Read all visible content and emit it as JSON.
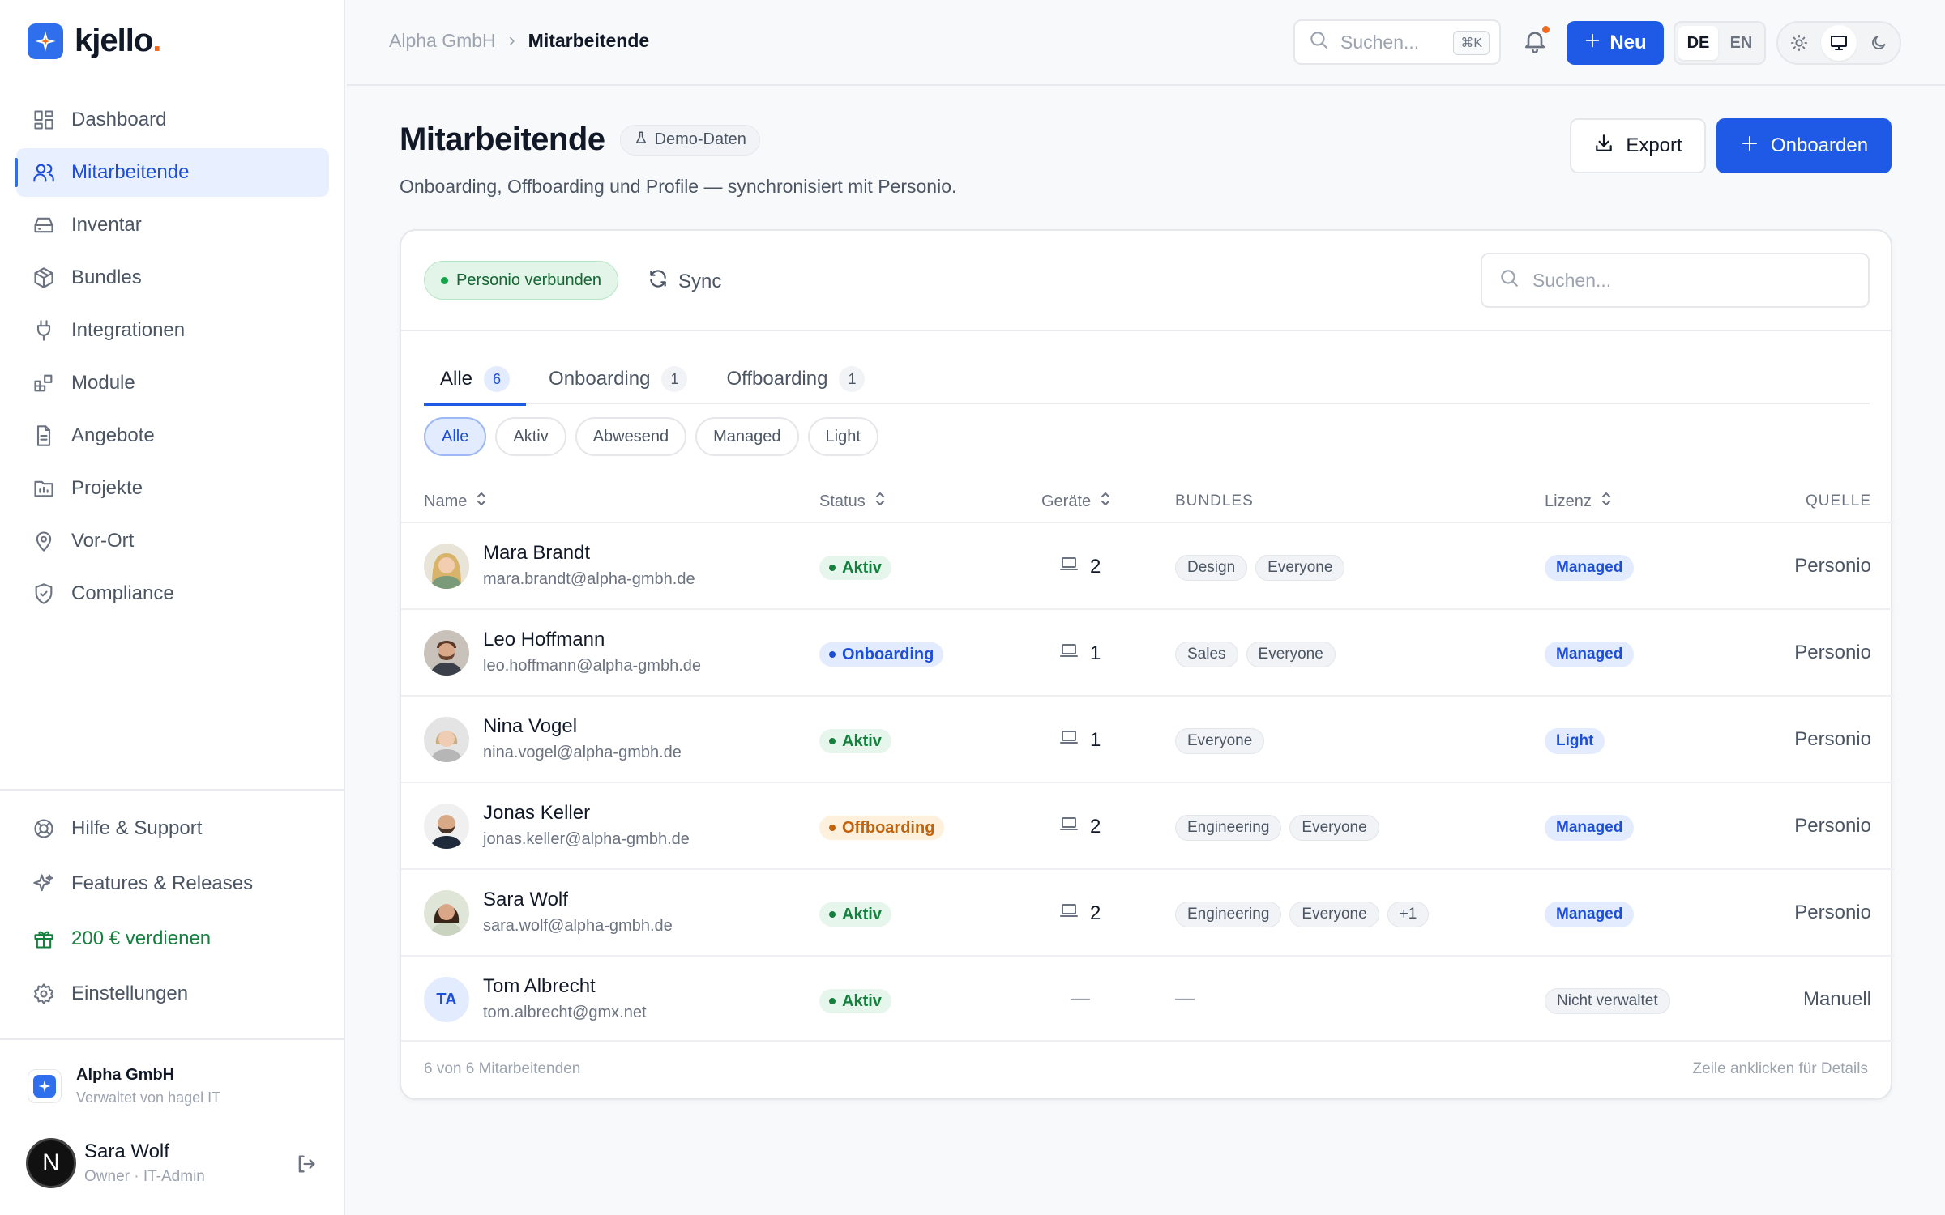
{
  "app": {
    "name": "kjello",
    "name_dot": "."
  },
  "sidebar": {
    "items": [
      {
        "label": "Dashboard",
        "icon": "grid-icon"
      },
      {
        "label": "Mitarbeitende",
        "icon": "users-icon",
        "active": true
      },
      {
        "label": "Inventar",
        "icon": "drive-icon"
      },
      {
        "label": "Bundles",
        "icon": "package-icon"
      },
      {
        "label": "Integrationen",
        "icon": "plug-icon"
      },
      {
        "label": "Module",
        "icon": "blocks-icon"
      },
      {
        "label": "Angebote",
        "icon": "document-icon"
      },
      {
        "label": "Projekte",
        "icon": "folder-icon"
      },
      {
        "label": "Vor-Ort",
        "icon": "map-pin-icon"
      },
      {
        "label": "Compliance",
        "icon": "shield-check-icon"
      }
    ],
    "bottom": [
      {
        "label": "Hilfe & Support",
        "icon": "lifebuoy-icon"
      },
      {
        "label": "Features & Releases",
        "icon": "sparkles-icon"
      },
      {
        "label": "200 € verdienen",
        "icon": "gift-icon"
      },
      {
        "label": "Einstellungen",
        "icon": "gear-icon"
      }
    ],
    "org": {
      "name": "Alpha GmbH",
      "managed_by": "Verwaltet von hagel IT"
    },
    "user": {
      "initial": "N",
      "name": "Sara Wolf",
      "role": "Owner · IT-Admin"
    }
  },
  "topbar": {
    "breadcrumb": {
      "parent": "Alpha GmbH",
      "separator": "›",
      "current": "Mitarbeitende"
    },
    "search_placeholder": "Suchen...",
    "search_shortcut": "⌘K",
    "new_label": "Neu",
    "languages": [
      "DE",
      "EN"
    ],
    "active_language": "DE"
  },
  "page": {
    "title": "Mitarbeitende",
    "demo_badge": "Demo-Daten",
    "subtitle": "Onboarding, Offboarding und Profile — synchronisiert mit Personio.",
    "export_label": "Export",
    "onboard_label": "Onboarden"
  },
  "card": {
    "connection": "Personio verbunden",
    "sync_label": "Sync",
    "search_placeholder": "Suchen...",
    "tabs": [
      {
        "label": "Alle",
        "count": "6"
      },
      {
        "label": "Onboarding",
        "count": "1"
      },
      {
        "label": "Offboarding",
        "count": "1"
      }
    ],
    "filters": [
      "Alle",
      "Aktiv",
      "Abwesend",
      "Managed",
      "Light"
    ],
    "columns": {
      "name": "Name",
      "status": "Status",
      "devices": "Geräte",
      "bundles": "BUNDLES",
      "license": "Lizenz",
      "source": "QUELLE"
    },
    "rows": [
      {
        "name": "Mara Brandt",
        "email": "mara.brandt@alpha-gmbh.de",
        "status": "Aktiv",
        "status_color": "green",
        "devices": "2",
        "bundles": [
          "Design",
          "Everyone"
        ],
        "license": "Managed",
        "source": "Personio",
        "avatar": "photo-blonde"
      },
      {
        "name": "Leo Hoffmann",
        "email": "leo.hoffmann@alpha-gmbh.de",
        "status": "Onboarding",
        "status_color": "blue",
        "devices": "1",
        "bundles": [
          "Sales",
          "Everyone"
        ],
        "license": "Managed",
        "source": "Personio",
        "avatar": "photo-beard"
      },
      {
        "name": "Nina Vogel",
        "email": "nina.vogel@alpha-gmbh.de",
        "status": "Aktiv",
        "status_color": "green",
        "devices": "1",
        "bundles": [
          "Everyone"
        ],
        "license": "Light",
        "source": "Personio",
        "avatar": "photo-short"
      },
      {
        "name": "Jonas Keller",
        "email": "jonas.keller@alpha-gmbh.de",
        "status": "Offboarding",
        "status_color": "orange",
        "devices": "2",
        "bundles": [
          "Engineering",
          "Everyone"
        ],
        "license": "Managed",
        "source": "Personio",
        "avatar": "photo-bald"
      },
      {
        "name": "Sara Wolf",
        "email": "sara.wolf@alpha-gmbh.de",
        "status": "Aktiv",
        "status_color": "green",
        "devices": "2",
        "bundles": [
          "Engineering",
          "Everyone",
          "+1"
        ],
        "license": "Managed",
        "source": "Personio",
        "avatar": "photo-dark"
      },
      {
        "name": "Tom Albrecht",
        "email": "tom.albrecht@gmx.net",
        "status": "Aktiv",
        "status_color": "green",
        "devices": "—",
        "bundles": [
          "—"
        ],
        "license": "Nicht verwaltet",
        "source": "Manuell",
        "avatar": "TA"
      }
    ],
    "footer_count": "6 von 6 Mitarbeitenden",
    "footer_hint": "Zeile anklicken für Details"
  },
  "colors": {
    "accent": "#1f5ae6",
    "brand_dot": "#f26b1d",
    "success": "#15803d",
    "warning": "#c2620a"
  }
}
